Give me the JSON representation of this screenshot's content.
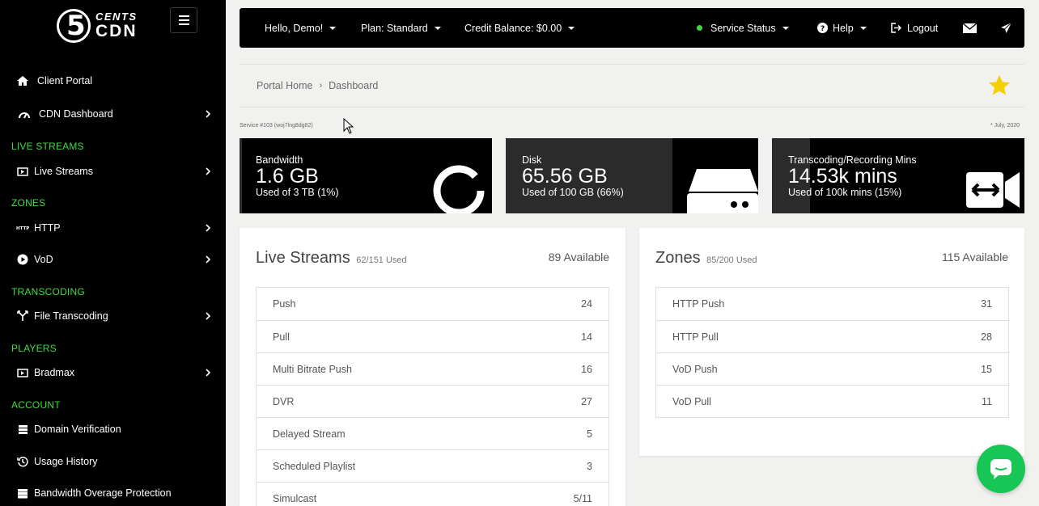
{
  "brand": {
    "top": "CENTS",
    "bottom": "CDN",
    "digit": "5"
  },
  "sidebar": {
    "items": [
      {
        "label": "Client Portal",
        "icon": "home-icon"
      },
      {
        "label": "CDN Dashboard",
        "icon": "speedometer-icon"
      },
      {
        "label": "Live Streams",
        "icon": "tv-icon"
      },
      {
        "label": "HTTP",
        "icon": "http-icon"
      },
      {
        "label": "VoD",
        "icon": "play-circle-icon"
      },
      {
        "label": "File Transcoding",
        "icon": "split-arrows-icon"
      },
      {
        "label": "Bradmax",
        "icon": "tv-icon"
      },
      {
        "label": "Domain Verification",
        "icon": "server-icon"
      },
      {
        "label": "Usage History",
        "icon": "history-icon"
      },
      {
        "label": "Bandwidth Overage Protection",
        "icon": "database-icon"
      }
    ],
    "sections": [
      "LIVE STREAMS",
      "ZONES",
      "TRANSCODING",
      "PLAYERS",
      "ACCOUNT"
    ]
  },
  "topbar": {
    "greeting": "Hello, Demo!",
    "plan": "Plan: Standard",
    "credit": "Credit Balance: $0.00",
    "status": "Service Status",
    "help": "Help",
    "logout": "Logout"
  },
  "breadcrumb": {
    "home": "Portal Home",
    "current": "Dashboard"
  },
  "service_info": "Service #103 (woj7lng8dg82)",
  "date_info": "* July, 2020",
  "stats": [
    {
      "label": "Bandwidth",
      "value": "1.6 GB",
      "sub": "Used of 3 TB (1%)",
      "fraction": 0.01
    },
    {
      "label": "Disk",
      "value": "65.56 GB",
      "sub": "Used of 100 GB (66%)",
      "fraction": 0.66
    },
    {
      "label": "Transcoding/Recording Mins",
      "value": "14.53k mins",
      "sub": "Used of 100k mins (15%)",
      "fraction": 0.15
    }
  ],
  "live_streams": {
    "title": "Live Streams",
    "used": "62/151 Used",
    "available": "89 Available",
    "rows": [
      {
        "k": "Push",
        "v": "24"
      },
      {
        "k": "Pull",
        "v": "14"
      },
      {
        "k": "Multi Bitrate Push",
        "v": "16"
      },
      {
        "k": "DVR",
        "v": "27"
      },
      {
        "k": "Delayed Stream",
        "v": "5"
      },
      {
        "k": "Scheduled Playlist",
        "v": "3"
      },
      {
        "k": "Simulcast",
        "v": "5/11"
      }
    ]
  },
  "zones": {
    "title": "Zones",
    "used": "85/200 Used",
    "available": "115 Available",
    "rows": [
      {
        "k": "HTTP Push",
        "v": "31"
      },
      {
        "k": "HTTP Pull",
        "v": "28"
      },
      {
        "k": "VoD Push",
        "v": "15"
      },
      {
        "k": "VoD Pull",
        "v": "11"
      }
    ]
  },
  "colors": {
    "accent": "#3ddc3d",
    "chat": "#17c654",
    "star": "#f5d000"
  }
}
